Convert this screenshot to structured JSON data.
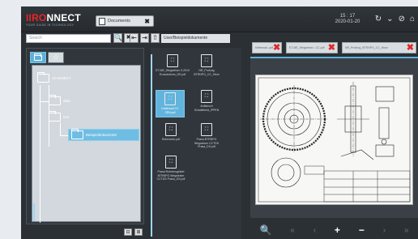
{
  "app": {
    "brand_accent": "IIRO",
    "brand_rest": "NNECT",
    "tagline": "YOUR GUIDE IN TECHNOLOGY",
    "accent_color": "#5fb0d8",
    "brand_color": "#e8262a"
  },
  "topbar": {
    "doc_tab_label": "Documents",
    "close_glyph": "✖",
    "clock_time": "15 : 17",
    "clock_date": "2020-01-20",
    "icons": [
      "refresh-icon",
      "chevron-down-icon",
      "no-wifi-icon",
      "home-icon"
    ]
  },
  "search": {
    "placeholder": "Search",
    "search_glyph": "🔍",
    "close_glyph": "✖",
    "nav_glyphs": [
      "⇤",
      "⇥",
      "⇧"
    ],
    "path": "User/Beispieldokumente"
  },
  "tree": {
    "nodes": [
      {
        "label": "ciiroNNECT"
      },
      {
        "label": "data"
      },
      {
        "label": "test"
      },
      {
        "label": "Beispieldokumente"
      }
    ],
    "bottom_icons": [
      "delete-icon",
      "trash-icon"
    ]
  },
  "files": [
    {
      "name": "ET-ME_Wegweiser 3-2019 Ecosolutions_DE.pdf"
    },
    {
      "name": "NR_Prufung BTRNPG_CC_Hinw"
    },
    {
      "name": "Kettenrad CC ZEN.pdf"
    },
    {
      "name": "Anflansch Schalldbeid_IPPEN"
    },
    {
      "name": "Rohrmotor.pdf"
    },
    {
      "name": "Prasa BTRNPG Wegweiser CCTDS Prasa_DS.pdf"
    },
    {
      "name": "Prasa Rohrkeugeldet BTRNPG Wegweiser CCTDS Prasa_DS.pdf"
    }
  ],
  "viewer": {
    "tabs": [
      {
        "label": "Kettenrad..pdf",
        "close": "✖"
      },
      {
        "label": "ET-ME_Wegweiser...CC.pdf",
        "close": "✖"
      },
      {
        "label": "NR_Prufung_BTRNPG_CC_Hinw",
        "close": "✖"
      },
      {
        "label": "",
        "close": "✖"
      }
    ],
    "controls": [
      "🔍",
      "«",
      "‹",
      "+",
      "−",
      "›",
      "»"
    ]
  }
}
